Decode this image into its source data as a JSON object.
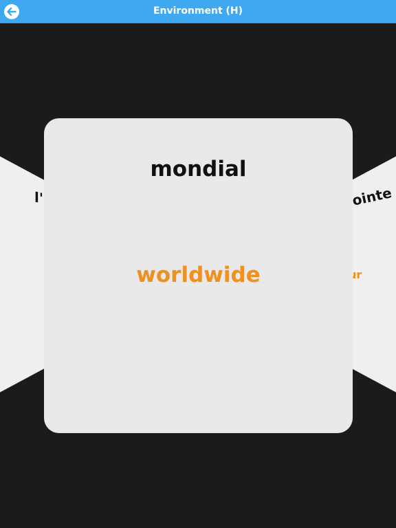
{
  "header": {
    "title": "Environment (H)",
    "back_icon": "back-arrow-icon",
    "color": "#3ea8f0"
  },
  "cards": {
    "current": {
      "term": "mondial",
      "translation": "worldwide"
    },
    "previous": {
      "term_partial": "l'i"
    },
    "next": {
      "term_partial": "ointe",
      "translation_partial": "ur"
    }
  },
  "colors": {
    "translation": "#f0901f",
    "background": "#1c1b1c",
    "card": "#e9e9e9"
  }
}
